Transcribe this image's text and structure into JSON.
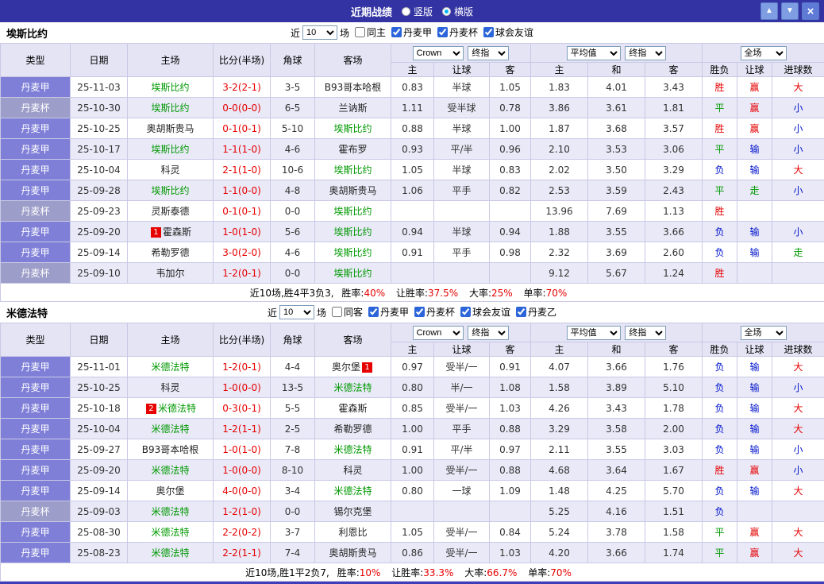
{
  "titlebar": {
    "title": "近期战绩",
    "layout_options": [
      {
        "label": "竖版",
        "selected": false
      },
      {
        "label": "横版",
        "selected": true
      }
    ],
    "icons": {
      "up": "▲",
      "down": "▼",
      "close": "×"
    }
  },
  "colors": {
    "titlebar_bg": "#3333a3",
    "league_primary": "#7f7fd8",
    "league_cup": "#9d9dc9",
    "result_win_red": "#e60000",
    "result_draw_green": "#009900",
    "result_lose_blue": "#0014cc",
    "focus_team_green": "#009900",
    "score_red": "#e60000"
  },
  "sections": [
    {
      "team": "埃斯比约",
      "filter": {
        "near_label": "近",
        "count": "10",
        "matches_label": "场",
        "checkboxes": [
          {
            "label": "同主",
            "checked": false
          },
          {
            "label": "丹麦甲",
            "checked": true
          },
          {
            "label": "丹麦杯",
            "checked": true
          },
          {
            "label": "球会友谊",
            "checked": true
          }
        ]
      },
      "header": {
        "cols": [
          "类型",
          "日期",
          "主场",
          "比分(半场)",
          "角球",
          "客场"
        ],
        "book_select": "Crown",
        "book_stage_select": "终指",
        "avg_select": "平均值",
        "avg_stage_select": "终指",
        "period_select": "全场",
        "odds_sub": [
          "主",
          "让球",
          "客"
        ],
        "avg_sub": [
          "主",
          "和",
          "客"
        ],
        "result_sub": [
          "胜负",
          "让球",
          "进球数"
        ]
      },
      "rows": [
        {
          "league": "丹麦甲",
          "kind": "jia",
          "date": "25-11-03",
          "home": "埃斯比约",
          "home_focus": true,
          "score": "3-2(2-1)",
          "corner": "3-5",
          "away": "B93哥本哈根",
          "away_focus": false,
          "odds": [
            "0.83",
            "半球",
            "1.05"
          ],
          "avg": [
            "1.83",
            "4.01",
            "3.43"
          ],
          "results": [
            {
              "t": "胜",
              "c": "red"
            },
            {
              "t": "赢",
              "c": "red"
            },
            {
              "t": "大",
              "c": "red"
            }
          ]
        },
        {
          "league": "丹麦杯",
          "kind": "cup",
          "date": "25-10-30",
          "home": "埃斯比约",
          "home_focus": true,
          "score": "0-0(0-0)",
          "corner": "6-5",
          "away": "兰讷斯",
          "away_focus": false,
          "odds": [
            "1.11",
            "受半球",
            "0.78"
          ],
          "avg": [
            "3.86",
            "3.61",
            "1.81"
          ],
          "results": [
            {
              "t": "平",
              "c": "green"
            },
            {
              "t": "赢",
              "c": "red"
            },
            {
              "t": "小",
              "c": "blue"
            }
          ]
        },
        {
          "league": "丹麦甲",
          "kind": "jia",
          "date": "25-10-25",
          "home": "奥胡斯贵马",
          "home_focus": false,
          "score": "0-1(0-1)",
          "corner": "5-10",
          "away": "埃斯比约",
          "away_focus": true,
          "odds": [
            "0.88",
            "半球",
            "1.00"
          ],
          "avg": [
            "1.87",
            "3.68",
            "3.57"
          ],
          "results": [
            {
              "t": "胜",
              "c": "red"
            },
            {
              "t": "赢",
              "c": "red"
            },
            {
              "t": "小",
              "c": "blue"
            }
          ]
        },
        {
          "league": "丹麦甲",
          "kind": "jia",
          "date": "25-10-17",
          "home": "埃斯比约",
          "home_focus": true,
          "score": "1-1(1-0)",
          "corner": "4-6",
          "away": "霍布罗",
          "away_focus": false,
          "odds": [
            "0.93",
            "平/半",
            "0.96"
          ],
          "avg": [
            "2.10",
            "3.53",
            "3.06"
          ],
          "results": [
            {
              "t": "平",
              "c": "green"
            },
            {
              "t": "输",
              "c": "blue"
            },
            {
              "t": "小",
              "c": "blue"
            }
          ]
        },
        {
          "league": "丹麦甲",
          "kind": "jia",
          "date": "25-10-04",
          "home": "科灵",
          "home_focus": false,
          "score": "2-1(1-0)",
          "corner": "10-6",
          "away": "埃斯比约",
          "away_focus": true,
          "odds": [
            "1.05",
            "半球",
            "0.83"
          ],
          "avg": [
            "2.02",
            "3.50",
            "3.29"
          ],
          "results": [
            {
              "t": "负",
              "c": "blue"
            },
            {
              "t": "输",
              "c": "blue"
            },
            {
              "t": "大",
              "c": "red"
            }
          ]
        },
        {
          "league": "丹麦甲",
          "kind": "jia",
          "date": "25-09-28",
          "home": "埃斯比约",
          "home_focus": true,
          "score": "1-1(0-0)",
          "corner": "4-8",
          "away": "奥胡斯贵马",
          "away_focus": false,
          "odds": [
            "1.06",
            "平手",
            "0.82"
          ],
          "avg": [
            "2.53",
            "3.59",
            "2.43"
          ],
          "results": [
            {
              "t": "平",
              "c": "green"
            },
            {
              "t": "走",
              "c": "green"
            },
            {
              "t": "小",
              "c": "blue"
            }
          ]
        },
        {
          "league": "丹麦杯",
          "kind": "cup",
          "date": "25-09-23",
          "home": "灵斯泰德",
          "home_focus": false,
          "score": "0-1(0-1)",
          "corner": "0-0",
          "away": "埃斯比约",
          "away_focus": true,
          "odds": [
            "",
            "",
            ""
          ],
          "avg": [
            "13.96",
            "7.69",
            "1.13"
          ],
          "results": [
            {
              "t": "胜",
              "c": "red"
            },
            {
              "t": "",
              "c": ""
            },
            {
              "t": "",
              "c": ""
            }
          ]
        },
        {
          "league": "丹麦甲",
          "kind": "jia",
          "date": "25-09-20",
          "home": "霍森斯",
          "home_focus": false,
          "home_badge_before": "1",
          "score": "1-0(1-0)",
          "corner": "5-6",
          "away": "埃斯比约",
          "away_focus": true,
          "odds": [
            "0.94",
            "半球",
            "0.94"
          ],
          "avg": [
            "1.88",
            "3.55",
            "3.66"
          ],
          "results": [
            {
              "t": "负",
              "c": "blue"
            },
            {
              "t": "输",
              "c": "blue"
            },
            {
              "t": "小",
              "c": "blue"
            }
          ]
        },
        {
          "league": "丹麦甲",
          "kind": "jia",
          "date": "25-09-14",
          "home": "希勒罗德",
          "home_focus": false,
          "score": "3-0(2-0)",
          "corner": "4-6",
          "away": "埃斯比约",
          "away_focus": true,
          "odds": [
            "0.91",
            "平手",
            "0.98"
          ],
          "avg": [
            "2.32",
            "3.69",
            "2.60"
          ],
          "results": [
            {
              "t": "负",
              "c": "blue"
            },
            {
              "t": "输",
              "c": "blue"
            },
            {
              "t": "走",
              "c": "green"
            }
          ]
        },
        {
          "league": "丹麦杯",
          "kind": "cup",
          "date": "25-09-10",
          "home": "韦加尔",
          "home_focus": false,
          "score": "1-2(0-1)",
          "corner": "0-0",
          "away": "埃斯比约",
          "away_focus": true,
          "odds": [
            "",
            "",
            ""
          ],
          "avg": [
            "9.12",
            "5.67",
            "1.24"
          ],
          "results": [
            {
              "t": "胜",
              "c": "red"
            },
            {
              "t": "",
              "c": ""
            },
            {
              "t": "",
              "c": ""
            }
          ]
        }
      ],
      "summary": {
        "lead": "近10场,胜4平3负3,",
        "stats": [
          {
            "label": "胜率:",
            "value": "40%"
          },
          {
            "label": "让胜率:",
            "value": "37.5%"
          },
          {
            "label": "大率:",
            "value": "25%"
          },
          {
            "label": "单率:",
            "value": "70%"
          }
        ]
      }
    },
    {
      "team": "米德法特",
      "filter": {
        "near_label": "近",
        "count": "10",
        "matches_label": "场",
        "checkboxes": [
          {
            "label": "同客",
            "checked": false
          },
          {
            "label": "丹麦甲",
            "checked": true
          },
          {
            "label": "丹麦杯",
            "checked": true
          },
          {
            "label": "球会友谊",
            "checked": true
          },
          {
            "label": "丹麦乙",
            "checked": true
          }
        ]
      },
      "header": {
        "cols": [
          "类型",
          "日期",
          "主场",
          "比分(半场)",
          "角球",
          "客场"
        ],
        "book_select": "Crown",
        "book_stage_select": "终指",
        "avg_select": "平均值",
        "avg_stage_select": "终指",
        "period_select": "全场",
        "odds_sub": [
          "主",
          "让球",
          "客"
        ],
        "avg_sub": [
          "主",
          "和",
          "客"
        ],
        "result_sub": [
          "胜负",
          "让球",
          "进球数"
        ]
      },
      "rows": [
        {
          "league": "丹麦甲",
          "kind": "jia",
          "date": "25-11-01",
          "home": "米德法特",
          "home_focus": true,
          "score": "1-2(0-1)",
          "corner": "4-4",
          "away": "奥尔堡",
          "away_focus": false,
          "away_badge_after": "1",
          "odds": [
            "0.97",
            "受半/一",
            "0.91"
          ],
          "avg": [
            "4.07",
            "3.66",
            "1.76"
          ],
          "results": [
            {
              "t": "负",
              "c": "blue"
            },
            {
              "t": "输",
              "c": "blue"
            },
            {
              "t": "大",
              "c": "red"
            }
          ]
        },
        {
          "league": "丹麦甲",
          "kind": "jia",
          "date": "25-10-25",
          "home": "科灵",
          "home_focus": false,
          "score": "1-0(0-0)",
          "corner": "13-5",
          "away": "米德法特",
          "away_focus": true,
          "odds": [
            "0.80",
            "半/一",
            "1.08"
          ],
          "avg": [
            "1.58",
            "3.89",
            "5.10"
          ],
          "results": [
            {
              "t": "负",
              "c": "blue"
            },
            {
              "t": "输",
              "c": "blue"
            },
            {
              "t": "小",
              "c": "blue"
            }
          ]
        },
        {
          "league": "丹麦甲",
          "kind": "jia",
          "date": "25-10-18",
          "home": "米德法特",
          "home_focus": true,
          "home_badge_before": "2",
          "score": "0-3(0-1)",
          "corner": "5-5",
          "away": "霍森斯",
          "away_focus": false,
          "odds": [
            "0.85",
            "受半/一",
            "1.03"
          ],
          "avg": [
            "4.26",
            "3.43",
            "1.78"
          ],
          "results": [
            {
              "t": "负",
              "c": "blue"
            },
            {
              "t": "输",
              "c": "blue"
            },
            {
              "t": "大",
              "c": "red"
            }
          ]
        },
        {
          "league": "丹麦甲",
          "kind": "jia",
          "date": "25-10-04",
          "home": "米德法特",
          "home_focus": true,
          "score": "1-2(1-1)",
          "corner": "2-5",
          "away": "希勒罗德",
          "away_focus": false,
          "odds": [
            "1.00",
            "平手",
            "0.88"
          ],
          "avg": [
            "3.29",
            "3.58",
            "2.00"
          ],
          "results": [
            {
              "t": "负",
              "c": "blue"
            },
            {
              "t": "输",
              "c": "blue"
            },
            {
              "t": "大",
              "c": "red"
            }
          ]
        },
        {
          "league": "丹麦甲",
          "kind": "jia",
          "date": "25-09-27",
          "home": "B93哥本哈根",
          "home_focus": false,
          "score": "1-0(1-0)",
          "corner": "7-8",
          "away": "米德法特",
          "away_focus": true,
          "odds": [
            "0.91",
            "平/半",
            "0.97"
          ],
          "avg": [
            "2.11",
            "3.55",
            "3.03"
          ],
          "results": [
            {
              "t": "负",
              "c": "blue"
            },
            {
              "t": "输",
              "c": "blue"
            },
            {
              "t": "小",
              "c": "blue"
            }
          ]
        },
        {
          "league": "丹麦甲",
          "kind": "jia",
          "date": "25-09-20",
          "home": "米德法特",
          "home_focus": true,
          "score": "1-0(0-0)",
          "corner": "8-10",
          "away": "科灵",
          "away_focus": false,
          "odds": [
            "1.00",
            "受半/一",
            "0.88"
          ],
          "avg": [
            "4.68",
            "3.64",
            "1.67"
          ],
          "results": [
            {
              "t": "胜",
              "c": "red"
            },
            {
              "t": "赢",
              "c": "red"
            },
            {
              "t": "小",
              "c": "blue"
            }
          ]
        },
        {
          "league": "丹麦甲",
          "kind": "jia",
          "date": "25-09-14",
          "home": "奥尔堡",
          "home_focus": false,
          "score": "4-0(0-0)",
          "corner": "3-4",
          "away": "米德法特",
          "away_focus": true,
          "odds": [
            "0.80",
            "一球",
            "1.09"
          ],
          "avg": [
            "1.48",
            "4.25",
            "5.70"
          ],
          "results": [
            {
              "t": "负",
              "c": "blue"
            },
            {
              "t": "输",
              "c": "blue"
            },
            {
              "t": "大",
              "c": "red"
            }
          ]
        },
        {
          "league": "丹麦杯",
          "kind": "cup",
          "date": "25-09-03",
          "home": "米德法特",
          "home_focus": true,
          "score": "1-2(1-0)",
          "corner": "0-0",
          "away": "锡尔克堡",
          "away_focus": false,
          "odds": [
            "",
            "",
            ""
          ],
          "avg": [
            "5.25",
            "4.16",
            "1.51"
          ],
          "results": [
            {
              "t": "负",
              "c": "blue"
            },
            {
              "t": "",
              "c": ""
            },
            {
              "t": "",
              "c": ""
            }
          ]
        },
        {
          "league": "丹麦甲",
          "kind": "jia",
          "date": "25-08-30",
          "home": "米德法特",
          "home_focus": true,
          "score": "2-2(0-2)",
          "corner": "3-7",
          "away": "利恩比",
          "away_focus": false,
          "odds": [
            "1.05",
            "受半/一",
            "0.84"
          ],
          "avg": [
            "5.24",
            "3.78",
            "1.58"
          ],
          "results": [
            {
              "t": "平",
              "c": "green"
            },
            {
              "t": "赢",
              "c": "red"
            },
            {
              "t": "大",
              "c": "red"
            }
          ]
        },
        {
          "league": "丹麦甲",
          "kind": "jia",
          "date": "25-08-23",
          "home": "米德法特",
          "home_focus": true,
          "score": "2-2(1-1)",
          "corner": "7-4",
          "away": "奥胡斯贵马",
          "away_focus": false,
          "odds": [
            "0.86",
            "受半/一",
            "1.03"
          ],
          "avg": [
            "4.20",
            "3.66",
            "1.74"
          ],
          "results": [
            {
              "t": "平",
              "c": "green"
            },
            {
              "t": "赢",
              "c": "red"
            },
            {
              "t": "大",
              "c": "red"
            }
          ]
        }
      ],
      "summary": {
        "lead": "近10场,胜1平2负7,",
        "stats": [
          {
            "label": "胜率:",
            "value": "10%"
          },
          {
            "label": "让胜率:",
            "value": "33.3%"
          },
          {
            "label": "大率:",
            "value": "66.7%"
          },
          {
            "label": "单率:",
            "value": "70%"
          }
        ]
      }
    }
  ]
}
